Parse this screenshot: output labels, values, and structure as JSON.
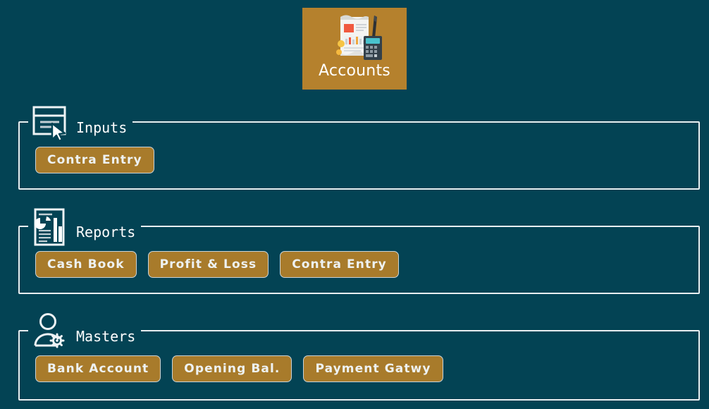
{
  "colors": {
    "background": "#034354",
    "tile": "#b5812d",
    "button": "#a87b2b",
    "border": "#e9eef0",
    "text": "#ffffff"
  },
  "module": {
    "label": "Accounts",
    "icon": "accounts-document-calculator-icon"
  },
  "sections": [
    {
      "id": "inputs",
      "title": "Inputs",
      "icon": "form-cursor-icon",
      "buttons": [
        {
          "label": "Contra Entry"
        }
      ]
    },
    {
      "id": "reports",
      "title": "Reports",
      "icon": "report-chart-icon",
      "buttons": [
        {
          "label": "Cash Book"
        },
        {
          "label": "Profit & Loss"
        },
        {
          "label": "Contra Entry"
        }
      ]
    },
    {
      "id": "masters",
      "title": "Masters",
      "icon": "user-gear-icon",
      "buttons": [
        {
          "label": "Bank Account"
        },
        {
          "label": "Opening Bal."
        },
        {
          "label": "Payment Gatwy"
        }
      ]
    }
  ]
}
